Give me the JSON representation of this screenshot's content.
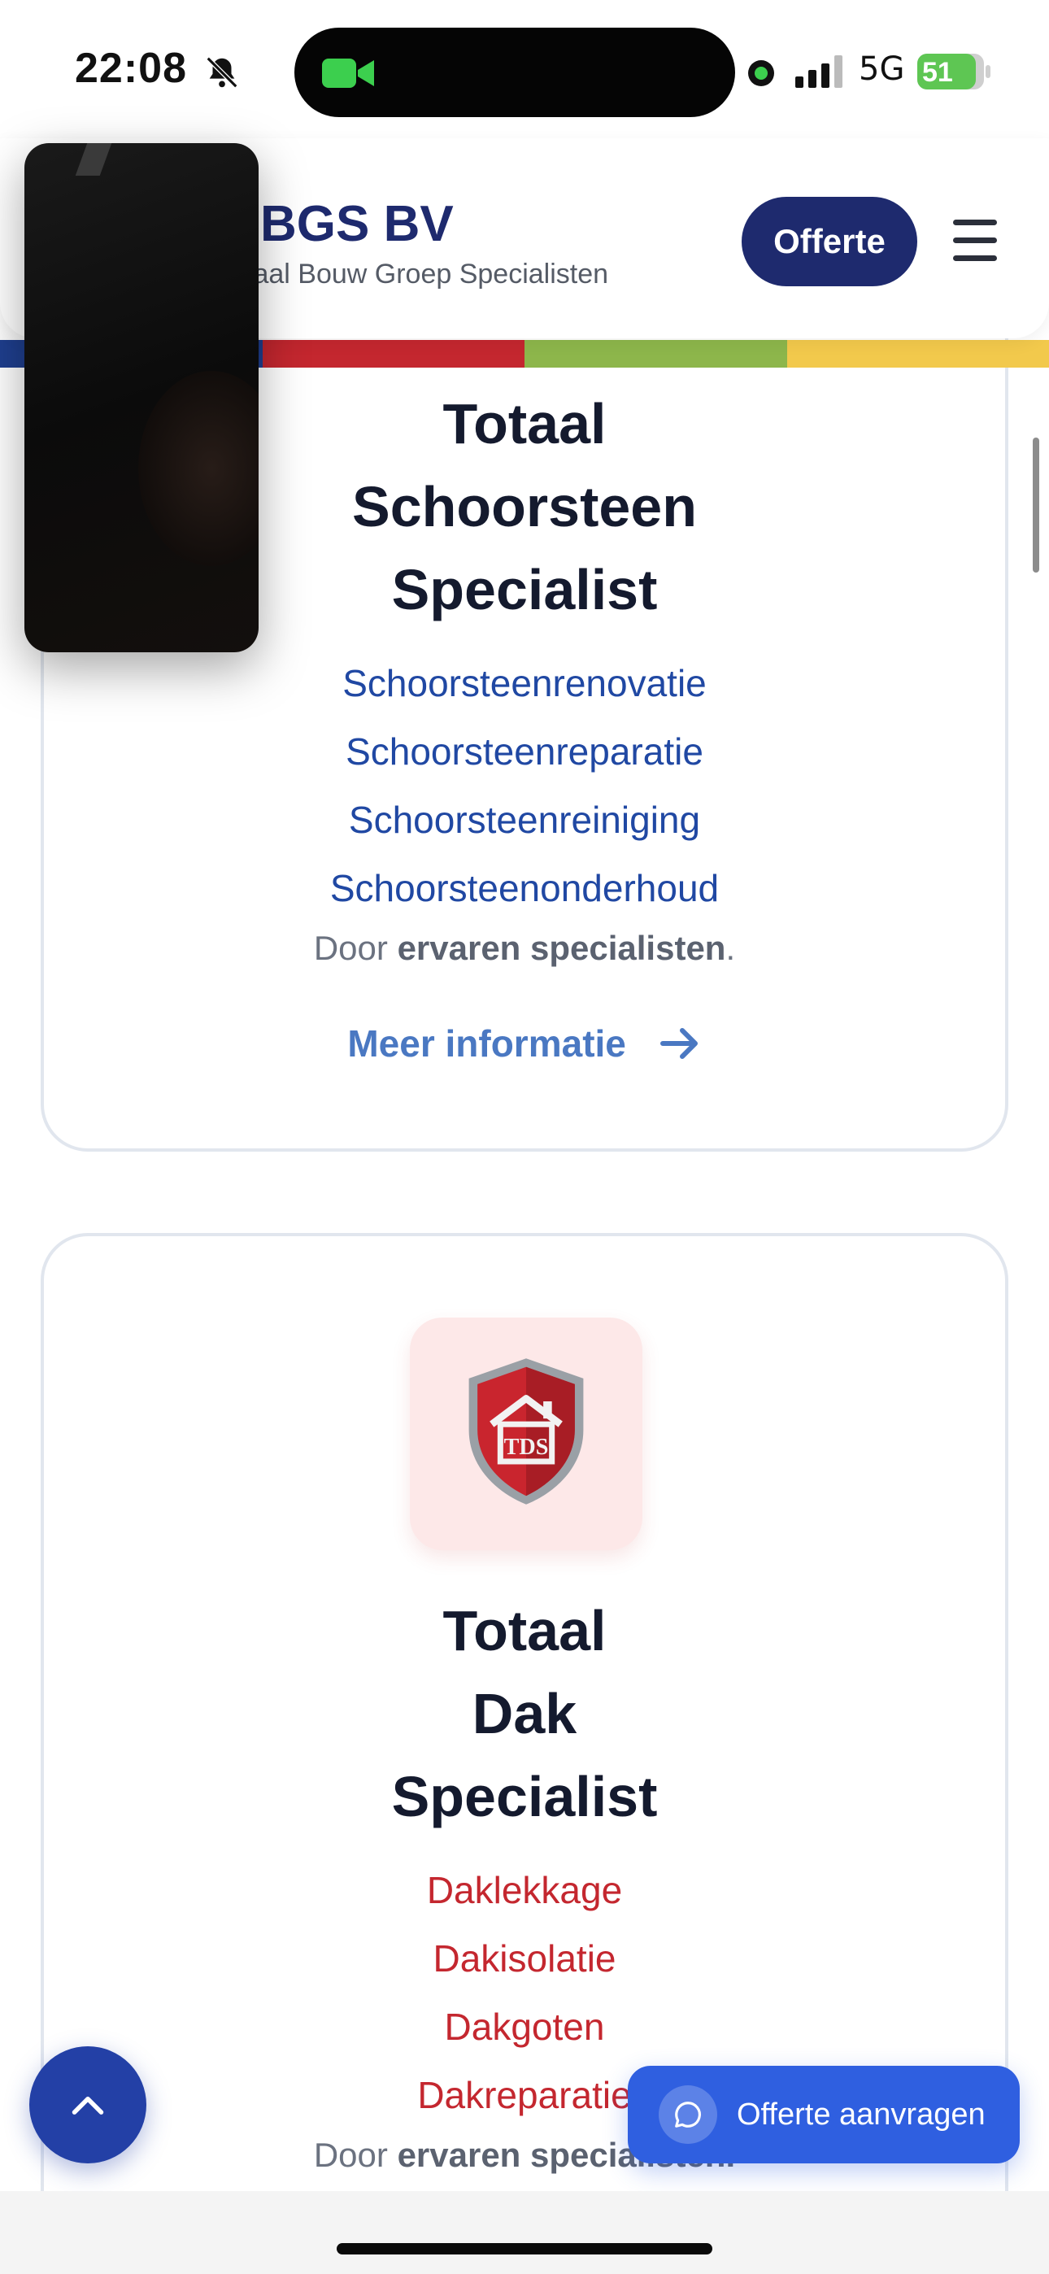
{
  "status_bar": {
    "time": "22:08",
    "network": "5G",
    "battery": "51",
    "icons": [
      "bell-muted-icon",
      "facetime-icon",
      "mic-active-icon",
      "signal-icon",
      "battery-charging-icon"
    ]
  },
  "header": {
    "brand": "BGS BV",
    "tagline": "taal Bouw Groep Specialisten",
    "offerte_label": "Offerte",
    "menu_icon": "hamburger-icon",
    "stripe_colors": [
      "#1f3f8f",
      "#c4272f",
      "#8db64b",
      "#f2c94c"
    ]
  },
  "cards": [
    {
      "title_lines": [
        "Totaal",
        "Schoorsteen",
        "Specialist"
      ],
      "services": [
        "Schoorsteenrenovatie",
        "Schoorsteenreparatie",
        "Schoorsteenreiniging",
        "Schoorsteenonderhoud"
      ],
      "door_prefix": "Door",
      "door_bold": "ervaren specialisten",
      "door_suffix": ".",
      "more_label": "Meer informatie",
      "accent": "#2048a3"
    },
    {
      "logo_icon": "shield-house-tds-icon",
      "logo_text": "TDS",
      "title_lines": [
        "Totaal",
        "Dak",
        "Specialist"
      ],
      "services": [
        "Daklekkage",
        "Dakisolatie",
        "Dakgoten",
        "Dakreparatie"
      ],
      "door_prefix": "Door",
      "door_bold": "ervaren specialisten.",
      "accent": "#c4272f"
    }
  ],
  "floating": {
    "scroll_top_icon": "chevron-up-icon",
    "quote_icon": "chat-bubble-icon",
    "quote_label": "Offerte aanvragen"
  }
}
